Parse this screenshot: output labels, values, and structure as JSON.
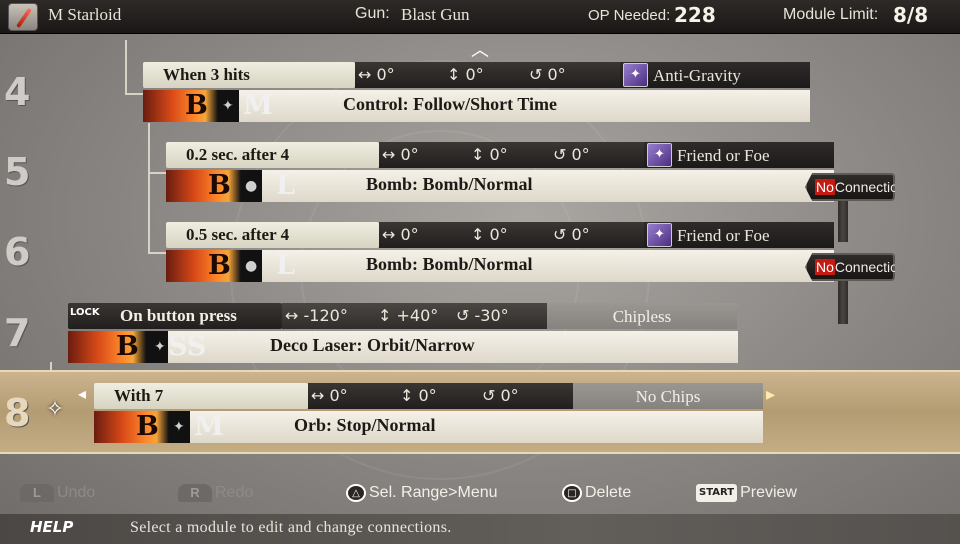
{
  "header": {
    "starloid_name": "M Starloid",
    "gun_label": "Gun:",
    "gun_name": "Blast Gun",
    "op_label": "OP Needed:",
    "op_value": "228",
    "limit_label": "Module Limit:",
    "limit_value": "8/8"
  },
  "row_numbers": [
    "4",
    "5",
    "6",
    "7",
    "8"
  ],
  "modules": [
    {
      "number": "4",
      "trigger": "When 3 hits",
      "angle_h": "0°",
      "angle_v": "0°",
      "rotation": "0°",
      "chip": "Anti-Gravity",
      "bullet_letter": "B",
      "size": "M",
      "body": "Control: Follow/Short Time"
    },
    {
      "number": "5",
      "trigger": "0.2 sec. after 4",
      "angle_h": "0°",
      "angle_v": "0°",
      "rotation": "0°",
      "chip": "Friend or Foe",
      "bullet_letter": "B",
      "size": "L",
      "body": "Bomb: Bomb/Normal",
      "connection_no": "No",
      "connection_label": "Connection"
    },
    {
      "number": "6",
      "trigger": "0.5 sec. after 4",
      "angle_h": "0°",
      "angle_v": "0°",
      "rotation": "0°",
      "chip": "Friend or Foe",
      "bullet_letter": "B",
      "size": "L",
      "body": "Bomb: Bomb/Normal",
      "connection_no": "No",
      "connection_label": "Connection"
    },
    {
      "number": "7",
      "lock_tag": "LOCK",
      "trigger": "On button press",
      "angle_h": "-120°",
      "angle_v": "+40°",
      "rotation": "-30°",
      "chip": "Chipless",
      "bullet_letter": "B",
      "size": "SS",
      "body": "Deco Laser: Orbit/Narrow"
    },
    {
      "number": "8",
      "trigger": "With 7",
      "angle_h": "0°",
      "angle_v": "0°",
      "rotation": "0°",
      "chip": "No Chips",
      "bullet_letter": "B",
      "size": "M",
      "body": "Orb: Stop/Normal",
      "selected": true
    }
  ],
  "icons": {
    "horizontal": "↔",
    "vertical": "↕",
    "rotation": "↺",
    "up_arrow": "︿",
    "left_arrow": "◂",
    "right_arrow": "▸",
    "chip": "✦",
    "cursor": "✧"
  },
  "footer": {
    "undo_icon": "L",
    "undo": "Undo",
    "redo_icon": "R",
    "redo": "Redo",
    "triangle_icon": "△",
    "sel_range": "Sel. Range>Menu",
    "square_icon": "□",
    "delete": "Delete",
    "start_icon": "START",
    "preview": "Preview",
    "help_label": "HELP",
    "help_text": "Select a module to edit and change connections."
  }
}
